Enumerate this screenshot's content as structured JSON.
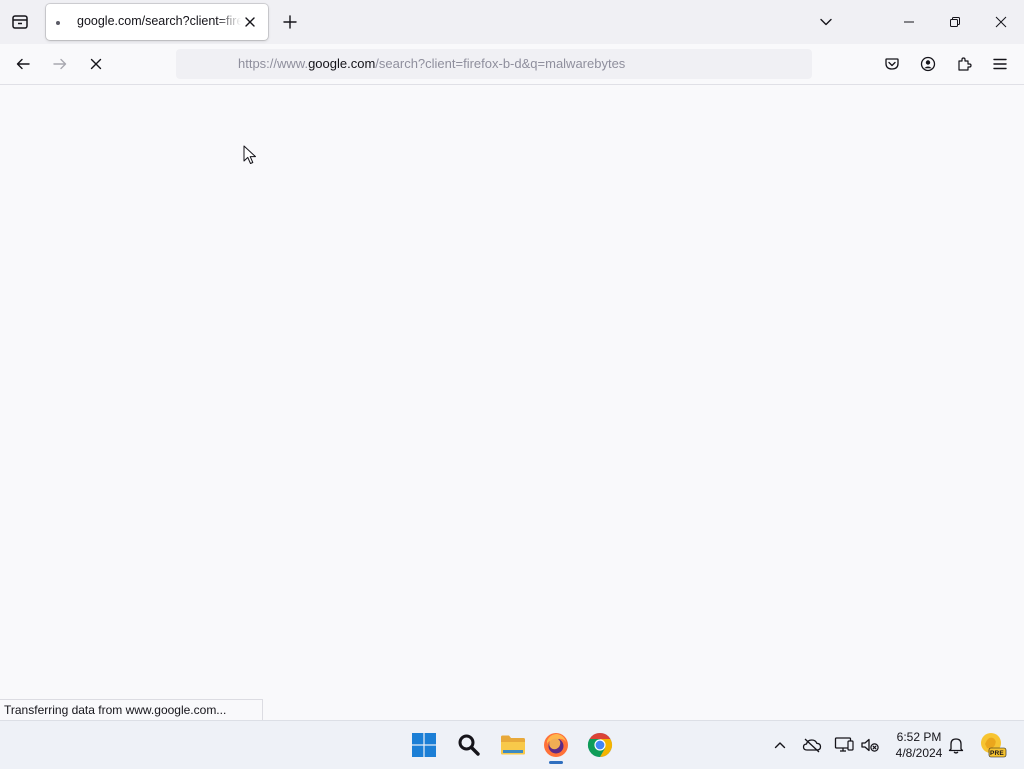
{
  "browser": {
    "tab": {
      "title": "google.com/search?client=firefox-b-d&q=malwarebytes"
    },
    "url": {
      "prefix": "https://www.",
      "domain": "google.com",
      "rest": "/search?client=firefox-b-d&q=malwarebytes"
    },
    "status_text": "Transferring data from www.google.com..."
  },
  "icons": {
    "tab_manager": "firefox-view-icon",
    "new_tab": "plus-icon",
    "list_all_tabs": "chevron-down-icon",
    "back": "back-arrow-icon",
    "forward": "forward-arrow-icon",
    "stop": "stop-icon",
    "pocket": "pocket-icon",
    "account": "account-icon",
    "extensions": "puzzle-icon",
    "menu": "hamburger-menu-icon"
  },
  "taskbar": {
    "apps": [
      "start",
      "search",
      "file-explorer",
      "firefox",
      "chrome"
    ],
    "active_app": "firefox",
    "clock": {
      "time": "6:52 PM",
      "date": "4/8/2024"
    },
    "badge": "PRE"
  },
  "colors": {
    "windows_accent": "#1c7fd6",
    "firefox_orange": "#ff7139",
    "chrome_red": "#db4437",
    "chrome_green": "#0f9d58",
    "chrome_yellow": "#f4b400",
    "chrome_blue": "#4285f4"
  }
}
